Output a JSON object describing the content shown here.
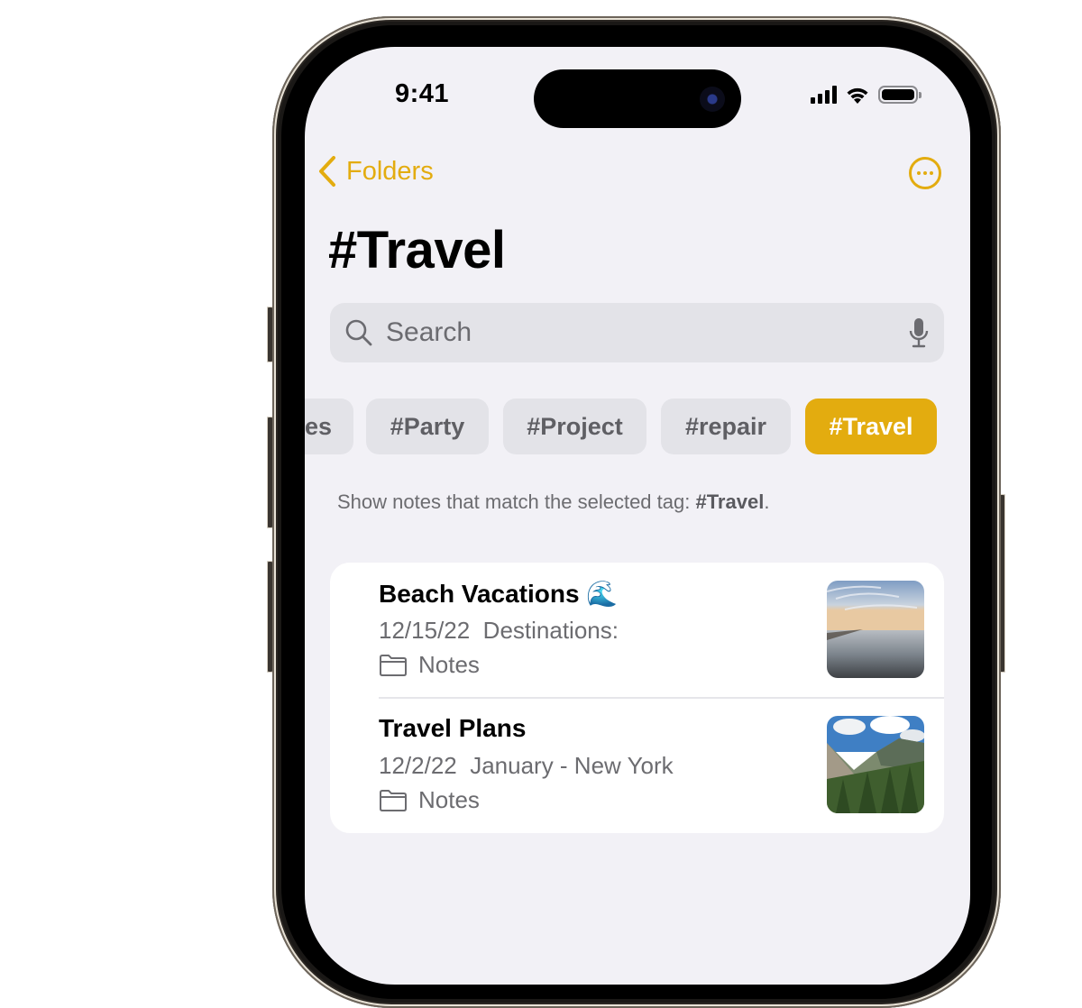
{
  "status_bar": {
    "time": "9:41"
  },
  "nav": {
    "back_label": "Folders",
    "more_icon": "ellipsis-circle-icon"
  },
  "page": {
    "title": "#Travel"
  },
  "search": {
    "placeholder": "Search",
    "value": ""
  },
  "tags": [
    {
      "label": "#Recipes",
      "visible_text": "es",
      "selected": false
    },
    {
      "label": "#Party",
      "selected": false
    },
    {
      "label": "#Project",
      "selected": false
    },
    {
      "label": "#repair",
      "selected": false
    },
    {
      "label": "#Travel",
      "selected": true
    }
  ],
  "hint": {
    "prefix": "Show notes that match the selected tag: ",
    "tag": "#Travel",
    "suffix": "."
  },
  "notes": [
    {
      "title": "Beach Vacations 🌊",
      "date": "12/15/22",
      "preview": "Destinations:",
      "folder": "Notes",
      "thumbnail": "beach-photo"
    },
    {
      "title": "Travel Plans",
      "date": "12/2/22",
      "preview": "January - New York",
      "folder": "Notes",
      "thumbnail": "mountain-forest-photo"
    }
  ],
  "colors": {
    "accent": "#e3ac0f",
    "background": "#f2f1f6",
    "chip": "#e3e3e8",
    "secondary_text": "#6c6c70"
  }
}
